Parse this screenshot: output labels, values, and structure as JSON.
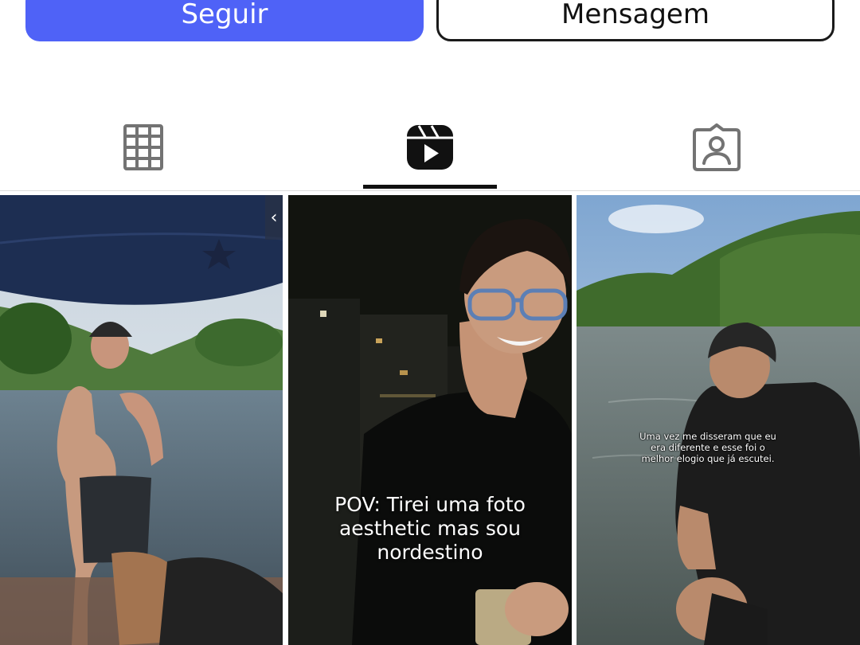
{
  "actions": {
    "follow_label": "Seguir",
    "message_label": "Mensagem",
    "follow_color": "#4f62f7"
  },
  "tabs": [
    {
      "icon": "grid-icon",
      "active": false
    },
    {
      "icon": "reels-icon",
      "active": true
    },
    {
      "icon": "tagged-icon",
      "active": false
    }
  ],
  "reels": [
    {
      "caption": ""
    },
    {
      "caption_lines": [
        "POV: Tirei uma foto",
        "aesthetic mas sou",
        "nordestino"
      ]
    },
    {
      "caption_lines": [
        "Uma vez me disseram que eu",
        "era diferente e esse foi o",
        "melhor elogio que já escutei."
      ]
    }
  ],
  "carousel_chevron": "‹"
}
